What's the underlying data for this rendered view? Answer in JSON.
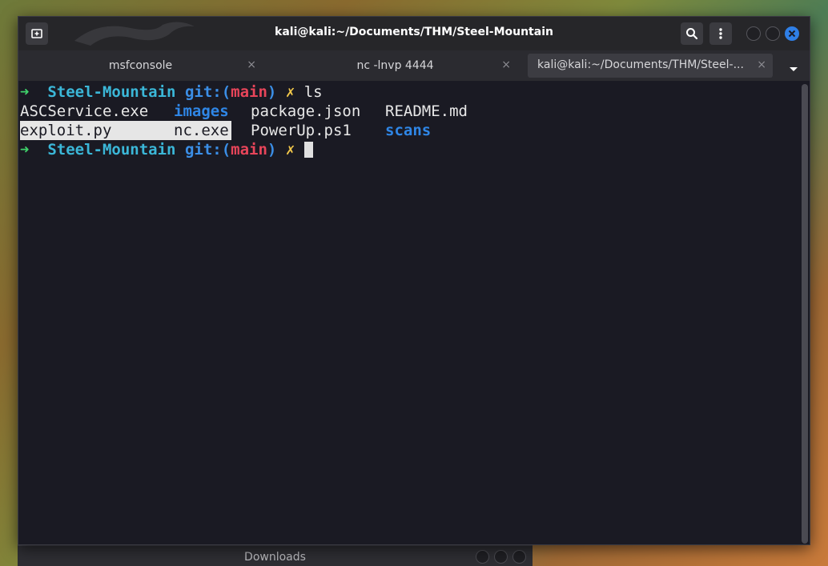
{
  "window": {
    "title": "kali@kali:~/Documents/THM/Steel-Mountain"
  },
  "tabs": [
    {
      "label": "msfconsole",
      "close": "×"
    },
    {
      "label": "nc -lnvp 4444",
      "close": "×"
    },
    {
      "label": "kali@kali:~/Documents/THM/Steel-...",
      "close": "×"
    }
  ],
  "terminal": {
    "prompt1": {
      "arrow": "➜",
      "dir": "Steel-Mountain",
      "git": "git:(",
      "branch": "main",
      "git_close": ")",
      "dirty": "✗",
      "command": "ls"
    },
    "ls_row1": [
      "ASCService.exe",
      "images",
      "package.json",
      "README.md"
    ],
    "ls_row2": [
      "exploit.py",
      "nc.exe",
      "PowerUp.ps1",
      "scans"
    ],
    "prompt2": {
      "arrow": "➜",
      "dir": "Steel-Mountain",
      "git": "git:(",
      "branch": "main",
      "git_close": ")",
      "dirty": "✗"
    }
  },
  "background_window": {
    "title": "Downloads"
  },
  "icons": {
    "new_tab": "new-tab-icon",
    "search": "search-icon",
    "menu": "kebab-menu-icon",
    "close": "close-icon",
    "dropdown": "chevron-down-icon"
  },
  "colors": {
    "arrow": "#3fd26b",
    "dir": "#3bb7d8",
    "git": "#3b8ee6",
    "branch": "#e8455a",
    "dirty": "#f3c84a",
    "directory_entry": "#2f86e6",
    "close_button": "#2f7fe6"
  }
}
